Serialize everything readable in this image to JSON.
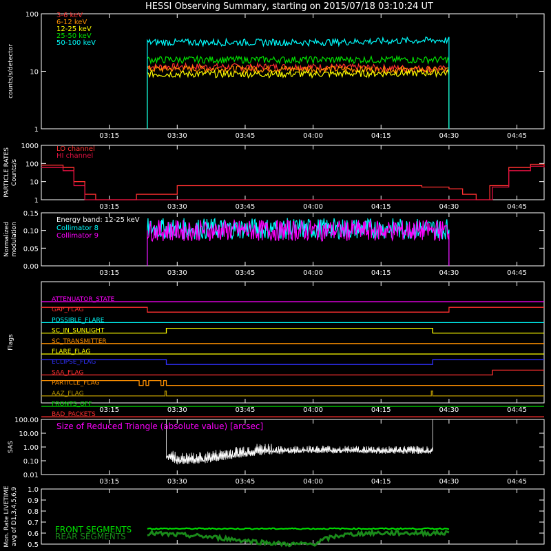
{
  "title": "HESSI Observing Summary, starting on 2015/07/18 03:10:24 UT",
  "colors": {
    "bg": "#000000",
    "axis": "#ffffff",
    "red": "#ff3030",
    "orange": "#ff9000",
    "yellow": "#ffff00",
    "green": "#00e000",
    "cyan": "#00ffff",
    "magenta": "#ff00ff",
    "blue": "#3030ff",
    "crimson": "#e01040",
    "olive": "#b09000"
  },
  "time_axis": {
    "range_min": [
      3.0,
      4.85
    ],
    "ticks": [
      "03:15",
      "03:30",
      "03:45",
      "04:00",
      "04:15",
      "04:30",
      "04:45"
    ],
    "tick_hours": [
      3.25,
      3.5,
      3.75,
      4.0,
      4.25,
      4.5,
      4.75
    ]
  },
  "chart_data": [
    {
      "type": "line",
      "panel": "count_rates",
      "ylabel": "counts/s/detector",
      "yscale": "log",
      "ylim": [
        1,
        100
      ],
      "yticks": [
        "1",
        "10",
        "100"
      ],
      "legend_placement": "top-left",
      "data_window": [
        3.39,
        4.5
      ],
      "series": [
        {
          "name": "3-6 keV",
          "color": "#ff3030",
          "level": 12,
          "ramp_end": 11
        },
        {
          "name": "6-12 keV",
          "color": "#ff9000",
          "level": 11,
          "ramp_end": 10.5
        },
        {
          "name": "12-25 keV",
          "color": "#ffff00",
          "level": 9,
          "ramp_end": 9.5
        },
        {
          "name": "25-50 keV",
          "color": "#00e000",
          "level": 16,
          "ramp_end": 16
        },
        {
          "name": "50-100 keV",
          "color": "#00ffff",
          "level": 32,
          "ramp_end": 35
        }
      ]
    },
    {
      "type": "line",
      "panel": "particle_rates",
      "ylabel": "PARTICLE RATES",
      "ylabel2": "Counts/s",
      "yscale": "log",
      "ylim": [
        1,
        1000
      ],
      "yticks": [
        "1",
        "10",
        "100",
        "1000"
      ],
      "legend_placement": "top-left",
      "series": [
        {
          "name": "LO channel",
          "color": "#ff3030",
          "x": [
            3.0,
            3.08,
            3.12,
            3.16,
            3.2,
            3.3,
            3.35,
            3.5,
            4.4,
            4.5,
            4.55,
            4.6,
            4.65,
            4.72,
            4.8,
            4.85
          ],
          "y": [
            80,
            60,
            10,
            2,
            1,
            1,
            2,
            6,
            5,
            4,
            2,
            1,
            6,
            60,
            90,
            70
          ]
        },
        {
          "name": "HI channel",
          "color": "#e01040",
          "x": [
            3.0,
            3.08,
            3.12,
            3.16,
            3.2,
            4.6,
            4.66,
            4.72,
            4.8,
            4.85
          ],
          "y": [
            60,
            40,
            6,
            1,
            1,
            1,
            5,
            40,
            70,
            60
          ]
        }
      ]
    },
    {
      "type": "line",
      "panel": "modulation",
      "ylabel": "Normalized",
      "ylabel2": "modulation",
      "ylim": [
        0,
        0.15
      ],
      "yticks": [
        "0.00",
        "0.05",
        "0.10",
        "0.15"
      ],
      "legend_placement": "top-left",
      "energy_band": "Energy band: 12-25 keV",
      "data_window": [
        3.39,
        4.5
      ],
      "series": [
        {
          "name": "Collimator 8",
          "color": "#00ffff",
          "level": 0.105
        },
        {
          "name": "Collimator 9",
          "color": "#ff00ff",
          "level": 0.1
        }
      ]
    },
    {
      "type": "line",
      "panel": "flags",
      "ylabel": "Flags",
      "flags": [
        {
          "name": "ATTENUATOR_STATE",
          "color": "#ff00ff",
          "x": [
            3.0,
            4.85
          ],
          "high": [
            0,
            0
          ]
        },
        {
          "name": "GAP_FLAG",
          "color": "#ff3030",
          "x": [
            3.0,
            3.39,
            4.5,
            4.85
          ],
          "high": [
            1,
            0,
            1,
            1
          ]
        },
        {
          "name": "POSSIBLE_FLARE",
          "color": "#00ffff",
          "x": [
            3.0,
            4.85
          ],
          "high": [
            0,
            0
          ]
        },
        {
          "name": "SC_IN_SUNLIGHT",
          "color": "#ffff00",
          "x": [
            3.0,
            3.46,
            4.44,
            4.85
          ],
          "high": [
            0,
            1,
            0,
            0
          ]
        },
        {
          "name": "SC_TRANSMITTER",
          "color": "#ff9000",
          "x": [
            3.0,
            4.85
          ],
          "high": [
            0,
            0
          ]
        },
        {
          "name": "FLARE_FLAG",
          "color": "#ffff00",
          "x": [
            3.0,
            4.85
          ],
          "high": [
            0,
            0
          ]
        },
        {
          "name": "ECLIPSE_FLAG",
          "color": "#3030ff",
          "x": [
            3.0,
            3.46,
            4.44,
            4.85
          ],
          "high": [
            1,
            0,
            1,
            1
          ]
        },
        {
          "name": "SAA_FLAG",
          "color": "#ff3030",
          "x": [
            3.0,
            4.66,
            4.85
          ],
          "high": [
            0,
            1,
            1
          ]
        },
        {
          "name": "PARTICLE_FLAG",
          "color": "#ff9000",
          "x": [
            3.0,
            3.36,
            3.375,
            3.385,
            3.395,
            3.44,
            3.45,
            3.46,
            4.85
          ],
          "high": [
            1,
            0,
            1,
            0,
            1,
            0,
            1,
            0,
            0
          ]
        },
        {
          "name": "AAZ_FLAG",
          "color": "#b09000",
          "x": [
            3.0,
            3.455,
            3.46,
            4.435,
            4.44,
            4.85
          ],
          "high": [
            0,
            1,
            0,
            1,
            0,
            0
          ]
        },
        {
          "name": "FRONTS_OFF",
          "color": "#00e000",
          "x": [
            3.0,
            4.85
          ],
          "high": [
            0,
            0
          ]
        },
        {
          "name": "BAD_PACKETS",
          "color": "#ff3030",
          "x": [
            3.0,
            4.85
          ],
          "high": [
            0,
            0
          ]
        }
      ]
    },
    {
      "type": "line",
      "panel": "sas",
      "ylabel": "SAS",
      "yscale": "log",
      "ylim": [
        0.01,
        100
      ],
      "yticks": [
        "0.01",
        "0.10",
        "1.00",
        "10.00",
        "100.00"
      ],
      "annotation": "Size of Reduced Triangle (absolute value) [arcsec]",
      "data_window": [
        3.46,
        4.44
      ],
      "series": [
        {
          "name": "",
          "color": "#ffffff",
          "x": [
            3.46,
            3.5,
            3.6,
            3.7,
            3.8,
            3.9,
            4.0,
            4.2,
            4.44
          ],
          "y": [
            0.2,
            0.08,
            0.1,
            0.2,
            0.4,
            0.5,
            0.55,
            0.5,
            0.5
          ]
        }
      ]
    },
    {
      "type": "line",
      "panel": "livetime",
      "ylabel": "Mon. Rate LIVETIME",
      "ylabel2": "avg of D1,3,4,5,6,9",
      "ylim": [
        0.5,
        1.0
      ],
      "yticks": [
        "0.5",
        "0.6",
        "0.7",
        "0.8",
        "0.9",
        "1.0"
      ],
      "legend_placement": "bottom-left",
      "data_window": [
        3.39,
        4.5
      ],
      "series": [
        {
          "name": "FRONT SEGMENTS",
          "color": "#00e000",
          "x": [
            3.39,
            4.5
          ],
          "y": [
            0.64,
            0.64
          ]
        },
        {
          "name": "REAR SEGMENTS",
          "color": "#1a8a1a",
          "x": [
            3.39,
            3.6,
            3.8,
            3.9,
            4.0,
            4.05,
            4.1,
            4.2,
            4.3,
            4.5
          ],
          "y": [
            0.6,
            0.57,
            0.52,
            0.5,
            0.5,
            0.55,
            0.58,
            0.6,
            0.6,
            0.6
          ]
        }
      ]
    }
  ]
}
